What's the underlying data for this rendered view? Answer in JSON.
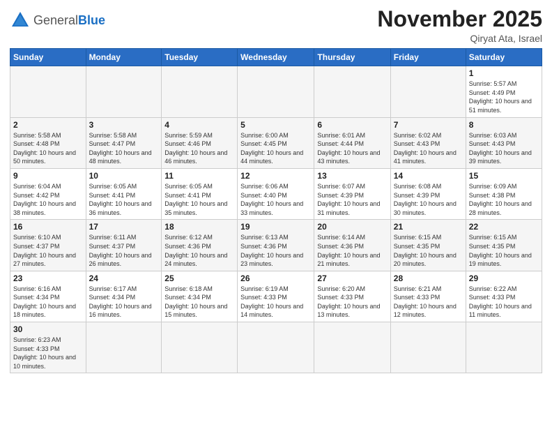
{
  "header": {
    "logo_general": "General",
    "logo_blue": "Blue",
    "month_title": "November 2025",
    "location": "Qiryat Ata, Israel"
  },
  "weekdays": [
    "Sunday",
    "Monday",
    "Tuesday",
    "Wednesday",
    "Thursday",
    "Friday",
    "Saturday"
  ],
  "weeks": [
    [
      {
        "day": "",
        "empty": true
      },
      {
        "day": "",
        "empty": true
      },
      {
        "day": "",
        "empty": true
      },
      {
        "day": "",
        "empty": true
      },
      {
        "day": "",
        "empty": true
      },
      {
        "day": "",
        "empty": true
      },
      {
        "day": "1",
        "sunrise": "5:57 AM",
        "sunset": "4:49 PM",
        "daylight": "10 hours and 51 minutes."
      }
    ],
    [
      {
        "day": "2",
        "sunrise": "5:58 AM",
        "sunset": "4:48 PM",
        "daylight": "10 hours and 50 minutes."
      },
      {
        "day": "3",
        "sunrise": "5:58 AM",
        "sunset": "4:47 PM",
        "daylight": "10 hours and 48 minutes."
      },
      {
        "day": "4",
        "sunrise": "5:59 AM",
        "sunset": "4:46 PM",
        "daylight": "10 hours and 46 minutes."
      },
      {
        "day": "5",
        "sunrise": "6:00 AM",
        "sunset": "4:45 PM",
        "daylight": "10 hours and 44 minutes."
      },
      {
        "day": "6",
        "sunrise": "6:01 AM",
        "sunset": "4:44 PM",
        "daylight": "10 hours and 43 minutes."
      },
      {
        "day": "7",
        "sunrise": "6:02 AM",
        "sunset": "4:43 PM",
        "daylight": "10 hours and 41 minutes."
      },
      {
        "day": "8",
        "sunrise": "6:03 AM",
        "sunset": "4:43 PM",
        "daylight": "10 hours and 39 minutes."
      }
    ],
    [
      {
        "day": "9",
        "sunrise": "6:04 AM",
        "sunset": "4:42 PM",
        "daylight": "10 hours and 38 minutes."
      },
      {
        "day": "10",
        "sunrise": "6:05 AM",
        "sunset": "4:41 PM",
        "daylight": "10 hours and 36 minutes."
      },
      {
        "day": "11",
        "sunrise": "6:05 AM",
        "sunset": "4:41 PM",
        "daylight": "10 hours and 35 minutes."
      },
      {
        "day": "12",
        "sunrise": "6:06 AM",
        "sunset": "4:40 PM",
        "daylight": "10 hours and 33 minutes."
      },
      {
        "day": "13",
        "sunrise": "6:07 AM",
        "sunset": "4:39 PM",
        "daylight": "10 hours and 31 minutes."
      },
      {
        "day": "14",
        "sunrise": "6:08 AM",
        "sunset": "4:39 PM",
        "daylight": "10 hours and 30 minutes."
      },
      {
        "day": "15",
        "sunrise": "6:09 AM",
        "sunset": "4:38 PM",
        "daylight": "10 hours and 28 minutes."
      }
    ],
    [
      {
        "day": "16",
        "sunrise": "6:10 AM",
        "sunset": "4:37 PM",
        "daylight": "10 hours and 27 minutes."
      },
      {
        "day": "17",
        "sunrise": "6:11 AM",
        "sunset": "4:37 PM",
        "daylight": "10 hours and 26 minutes."
      },
      {
        "day": "18",
        "sunrise": "6:12 AM",
        "sunset": "4:36 PM",
        "daylight": "10 hours and 24 minutes."
      },
      {
        "day": "19",
        "sunrise": "6:13 AM",
        "sunset": "4:36 PM",
        "daylight": "10 hours and 23 minutes."
      },
      {
        "day": "20",
        "sunrise": "6:14 AM",
        "sunset": "4:36 PM",
        "daylight": "10 hours and 21 minutes."
      },
      {
        "day": "21",
        "sunrise": "6:15 AM",
        "sunset": "4:35 PM",
        "daylight": "10 hours and 20 minutes."
      },
      {
        "day": "22",
        "sunrise": "6:15 AM",
        "sunset": "4:35 PM",
        "daylight": "10 hours and 19 minutes."
      }
    ],
    [
      {
        "day": "23",
        "sunrise": "6:16 AM",
        "sunset": "4:34 PM",
        "daylight": "10 hours and 18 minutes."
      },
      {
        "day": "24",
        "sunrise": "6:17 AM",
        "sunset": "4:34 PM",
        "daylight": "10 hours and 16 minutes."
      },
      {
        "day": "25",
        "sunrise": "6:18 AM",
        "sunset": "4:34 PM",
        "daylight": "10 hours and 15 minutes."
      },
      {
        "day": "26",
        "sunrise": "6:19 AM",
        "sunset": "4:33 PM",
        "daylight": "10 hours and 14 minutes."
      },
      {
        "day": "27",
        "sunrise": "6:20 AM",
        "sunset": "4:33 PM",
        "daylight": "10 hours and 13 minutes."
      },
      {
        "day": "28",
        "sunrise": "6:21 AM",
        "sunset": "4:33 PM",
        "daylight": "10 hours and 12 minutes."
      },
      {
        "day": "29",
        "sunrise": "6:22 AM",
        "sunset": "4:33 PM",
        "daylight": "10 hours and 11 minutes."
      }
    ],
    [
      {
        "day": "30",
        "sunrise": "6:23 AM",
        "sunset": "4:33 PM",
        "daylight": "10 hours and 10 minutes."
      },
      {
        "day": "",
        "empty": true
      },
      {
        "day": "",
        "empty": true
      },
      {
        "day": "",
        "empty": true
      },
      {
        "day": "",
        "empty": true
      },
      {
        "day": "",
        "empty": true
      },
      {
        "day": "",
        "empty": true
      }
    ]
  ]
}
